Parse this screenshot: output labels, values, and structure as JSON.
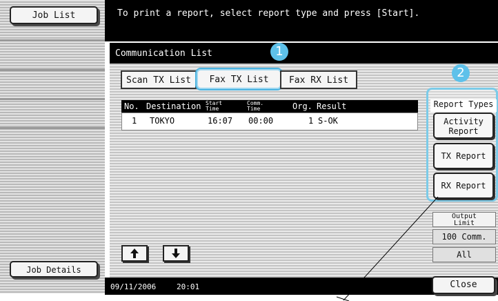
{
  "left_panel": {
    "job_list_label": "Job List",
    "job_details_label": "Job Details"
  },
  "message": "To print a report, select report type and press [Start].",
  "dialog": {
    "title": "Communication List",
    "tabs": [
      {
        "label": "Scan TX List",
        "active": false
      },
      {
        "label": "Fax TX List",
        "active": true
      },
      {
        "label": "Fax RX List",
        "active": false
      }
    ],
    "table": {
      "headers": {
        "no": "No.",
        "destination": "Destination",
        "start_time_1": "Start",
        "start_time_2": "Time",
        "comm_time_1": "Comm.",
        "comm_time_2": "Time",
        "org": "Org.",
        "result": "Result"
      },
      "rows": [
        {
          "no": "1",
          "destination": "TOKYO",
          "start_time": "16:07",
          "comm_time": "00:00",
          "org": "1",
          "result": "S-OK"
        }
      ]
    }
  },
  "callouts": {
    "one": "1",
    "two": "2"
  },
  "report_types": {
    "label": "Report Types",
    "buttons": {
      "activity_1": "Activity",
      "activity_2": "Report",
      "tx": "TX Report",
      "rx": "RX Report"
    }
  },
  "output_limit": {
    "label_1": "Output",
    "label_2": "Limit",
    "options": {
      "comm": "100 Comm.",
      "all": "All"
    }
  },
  "status": {
    "date": "09/11/2006",
    "time": "20:01"
  },
  "close_label": "Close",
  "colors": {
    "callout": "#5ec1ea",
    "highlight": "#7ccbe8",
    "bar": "#000000"
  },
  "icons": {
    "up": "up-arrow-icon",
    "down": "down-arrow-icon"
  }
}
